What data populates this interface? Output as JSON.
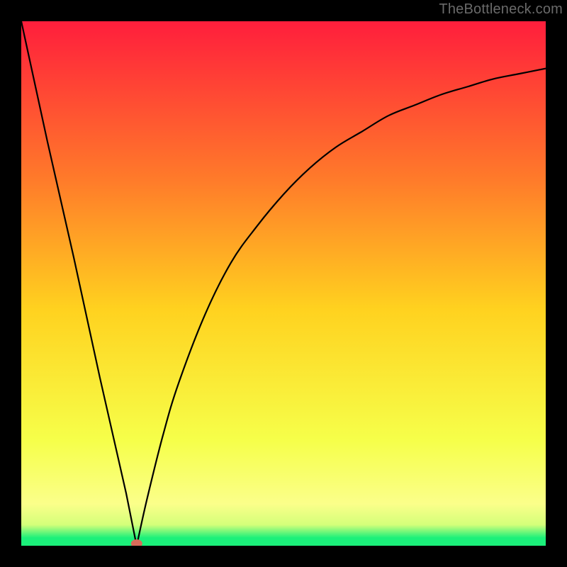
{
  "watermark": "TheBottleneck.com",
  "colors": {
    "frame": "#000000",
    "gradient_top": "#ff1e3c",
    "gradient_upper_mid": "#ff7a2a",
    "gradient_mid": "#ffd21f",
    "gradient_lower_mid": "#f6ff4a",
    "gradient_yellow_band": "#fbff8a",
    "gradient_green": "#1bf07a",
    "curve": "#000000",
    "marker": "#d86b5a"
  },
  "chart_data": {
    "type": "line",
    "title": "",
    "xlabel": "",
    "ylabel": "",
    "xlim": [
      0,
      100
    ],
    "ylim": [
      0,
      100
    ],
    "series": [
      {
        "name": "bottleneck-curve-left",
        "x": [
          0,
          5,
          10,
          15,
          20,
          22
        ],
        "values": [
          100,
          77,
          55,
          32,
          10,
          0
        ]
      },
      {
        "name": "bottleneck-curve-right",
        "x": [
          22,
          24,
          27,
          30,
          35,
          40,
          45,
          50,
          55,
          60,
          65,
          70,
          75,
          80,
          85,
          90,
          95,
          100
        ],
        "values": [
          0,
          9,
          21,
          31,
          44,
          54,
          61,
          67,
          72,
          76,
          79,
          82,
          84,
          86,
          87.5,
          89,
          90,
          91
        ]
      }
    ],
    "marker": {
      "x": 22,
      "y": 0,
      "label": "optimal-point"
    }
  }
}
